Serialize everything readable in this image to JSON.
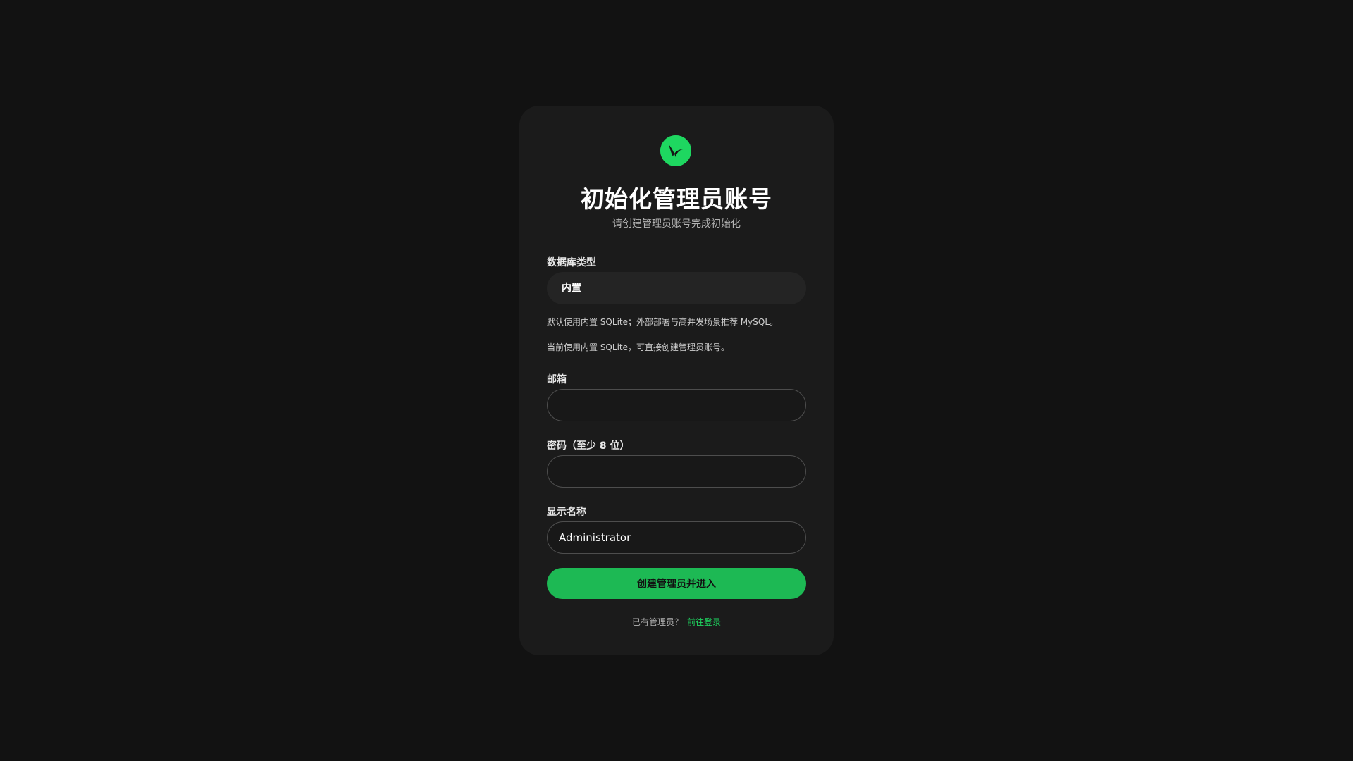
{
  "logo": {
    "icon": "brand-logo-icon",
    "color": "#1ed760"
  },
  "header": {
    "title": "初始化管理员账号",
    "subtitle": "请创建管理员账号完成初始化"
  },
  "form": {
    "db_type": {
      "label": "数据库类型",
      "value": "内置"
    },
    "hints": [
      "默认使用内置 SQLite；外部部署与高并发场景推荐 MySQL。",
      "当前使用内置 SQLite，可直接创建管理员账号。"
    ],
    "email": {
      "label": "邮箱",
      "value": ""
    },
    "password": {
      "label": "密码（至少 8 位）",
      "value": ""
    },
    "display_name": {
      "label": "显示名称",
      "value": "Administrator"
    },
    "submit_label": "创建管理员并进入"
  },
  "footer": {
    "text": "已有管理员？",
    "link_label": "前往登录"
  },
  "colors": {
    "background": "#121212",
    "card": "#1b1b1b",
    "accent": "#1db954"
  }
}
